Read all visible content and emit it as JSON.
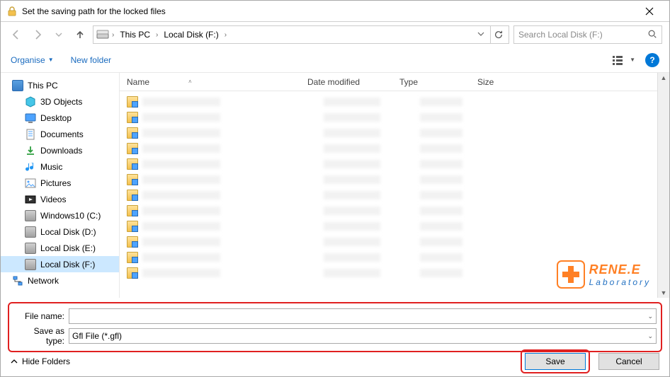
{
  "window": {
    "title": "Set the saving path for the locked files"
  },
  "nav": {
    "breadcrumb": [
      {
        "label": "This PC"
      },
      {
        "label": "Local Disk (F:)"
      }
    ],
    "search_placeholder": "Search Local Disk (F:)"
  },
  "cmdbar": {
    "organise": "Organise",
    "newfolder": "New folder"
  },
  "tree": [
    {
      "label": "This PC",
      "icon": "pc",
      "sub": false
    },
    {
      "label": "3D Objects",
      "icon": "3d",
      "sub": true
    },
    {
      "label": "Desktop",
      "icon": "desktop",
      "sub": true
    },
    {
      "label": "Documents",
      "icon": "docs",
      "sub": true
    },
    {
      "label": "Downloads",
      "icon": "downloads",
      "sub": true
    },
    {
      "label": "Music",
      "icon": "music",
      "sub": true
    },
    {
      "label": "Pictures",
      "icon": "pictures",
      "sub": true
    },
    {
      "label": "Videos",
      "icon": "videos",
      "sub": true
    },
    {
      "label": "Windows10 (C:)",
      "icon": "drive",
      "sub": true
    },
    {
      "label": "Local Disk (D:)",
      "icon": "drive",
      "sub": true
    },
    {
      "label": "Local Disk (E:)",
      "icon": "drive",
      "sub": true
    },
    {
      "label": "Local Disk (F:)",
      "icon": "drive",
      "sub": true,
      "selected": true
    },
    {
      "label": "Network",
      "icon": "network",
      "sub": false
    }
  ],
  "columns": {
    "name": "Name",
    "date": "Date modified",
    "type": "Type",
    "size": "Size"
  },
  "form": {
    "filename_label": "File name:",
    "filename_value": "",
    "saveastype_label": "Save as type:",
    "saveastype_value": "Gfl File (*.gfl)"
  },
  "footer": {
    "hide": "Hide Folders",
    "save": "Save",
    "cancel": "Cancel"
  },
  "watermark": {
    "line1": "RENE.E",
    "line2": "Laboratory"
  }
}
